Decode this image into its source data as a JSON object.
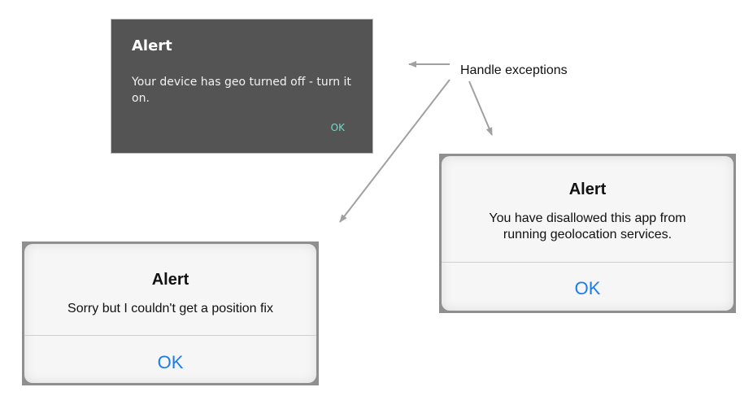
{
  "annotation": {
    "label": "Handle exceptions",
    "arrow_color": "#a0a0a0"
  },
  "android_alert": {
    "title": "Alert",
    "message": "Your device has geo turned off - turn it on.",
    "ok_label": "OK",
    "background_color": "#545454",
    "button_color": "#7fd3c6"
  },
  "ios_alert_disallowed": {
    "title": "Alert",
    "message_line1": "You have disallowed this app from",
    "message_line2": "running geolocation services.",
    "ok_label": "OK",
    "button_color": "#1a7cf0"
  },
  "ios_alert_position": {
    "title": "Alert",
    "message": "Sorry but I couldn't get a position fix",
    "ok_label": "OK",
    "button_color": "#1a7cf0"
  }
}
